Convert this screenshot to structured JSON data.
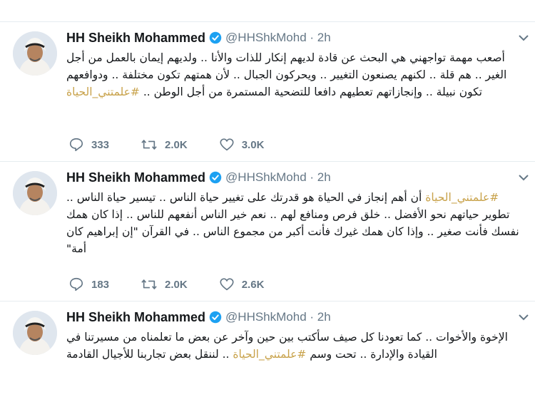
{
  "tweets": [
    {
      "author_name": "HH Sheikh Mohammed",
      "handle_time": "@HHShkMohd · 2h",
      "text_plain": "أصعب مهمة تواجهني هي البحث عن قادة لديهم إنكار للذات والأنا .. ولديهم إيمان بالعمل من أجل الغير .. هم قلة .. لكنهم يصنعون التغيير .. ويحركون الجبال .. لأن همتهم تكون مختلفة .. ودوافعهم تكون نبيلة .. وإنجازاتهم تعطيهم دافعا للتضحية المستمرة من أجل الوطن .. ",
      "hashtag": "#علمتني_الحياة",
      "replies": "333",
      "retweets": "2.0K",
      "likes": "3.0K"
    },
    {
      "author_name": "HH Sheikh Mohammed",
      "handle_time": "@HHShkMohd · 2h",
      "hashtag": "#علمتني_الحياة",
      "text_plain": " أن أهم إنجاز في الحياة هو قدرتك على تغيير حياة الناس .. تيسير حياة الناس .. تطوير حياتهم نحو الأفضل .. خلق فرص ومنافع لهم .. نعم خير الناس أنفعهم للناس .. إذا كان همك نفسك فأنت صغير .. وإذا كان همك غيرك فأنت أكبر من مجموع الناس .. في القرآن \"إن إبراهيم كان أمة\"",
      "replies": "183",
      "retweets": "2.0K",
      "likes": "2.6K"
    },
    {
      "author_name": "HH Sheikh Mohammed",
      "handle_time": "@HHShkMohd · 2h",
      "text_part1": "الإخوة والأخوات .. كما تعودنا كل صيف سأكتب بين حين وآخر عن بعض ما تعلمناه من مسيرتنا في القيادة والإدارة .. تحت وسم ",
      "hashtag": "#علمتني_الحياة",
      "text_part2": " .. لننقل بعض تجاربنا للأجيال القادمة"
    }
  ],
  "icons": {
    "reply": "reply-icon",
    "retweet": "retweet-icon",
    "like": "heart-icon",
    "verified": "verified-badge-icon",
    "caret": "chevron-down-icon"
  },
  "colors": {
    "hashtag": "#c8a24a",
    "verified": "#1da1f2",
    "meta": "#657786"
  }
}
